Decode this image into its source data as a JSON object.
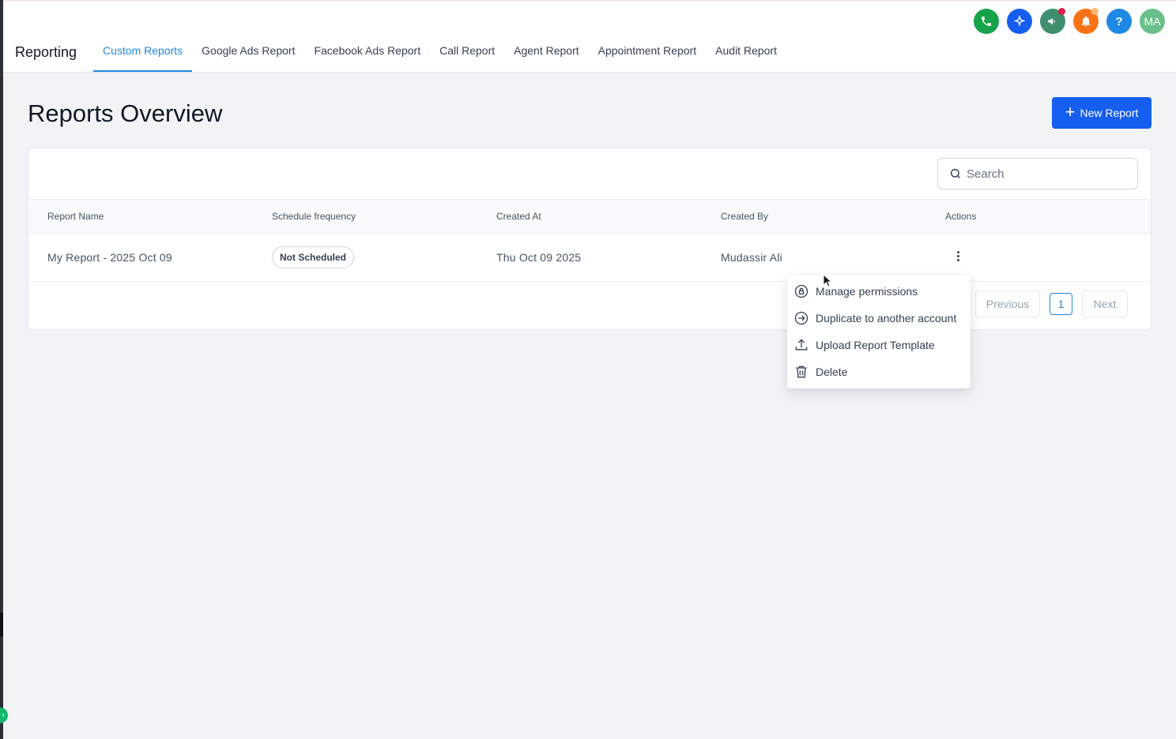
{
  "app": {
    "title": "Reporting"
  },
  "tabs": [
    {
      "label": "Custom Reports",
      "active": true
    },
    {
      "label": "Google Ads Report"
    },
    {
      "label": "Facebook Ads Report"
    },
    {
      "label": "Call Report"
    },
    {
      "label": "Agent Report"
    },
    {
      "label": "Appointment Report"
    },
    {
      "label": "Audit Report"
    }
  ],
  "header_icons": [
    {
      "name": "phone-icon",
      "color": "#16a34a"
    },
    {
      "name": "sparkle-icon",
      "color": "#155eef"
    },
    {
      "name": "megaphone-icon",
      "color": "#3f8f6f"
    },
    {
      "name": "bell-icon",
      "color": "#f97316"
    },
    {
      "name": "help-icon",
      "color": "#1e88e5",
      "glyph": "?"
    },
    {
      "name": "avatar",
      "color": "#6bbf8a",
      "initials": "MA"
    }
  ],
  "page": {
    "title": "Reports Overview",
    "new_button": "New Report",
    "search_placeholder": "Search"
  },
  "table": {
    "headers": [
      "Report Name",
      "Schedule frequency",
      "Created At",
      "Created By",
      "Actions"
    ],
    "rows": [
      {
        "name": "My Report - 2025 Oct 09",
        "schedule": "Not Scheduled",
        "created_at": "Thu Oct 09 2025",
        "created_by": "Mudassir Ali"
      }
    ]
  },
  "pagination": {
    "previous": "Previous",
    "current": "1",
    "next": "Next"
  },
  "actions_menu": [
    {
      "label": "Manage permissions",
      "icon": "lock-icon"
    },
    {
      "label": "Duplicate to another account",
      "icon": "duplicate-icon"
    },
    {
      "label": "Upload Report Template",
      "icon": "upload-icon"
    },
    {
      "label": "Delete",
      "icon": "trash-icon"
    }
  ]
}
